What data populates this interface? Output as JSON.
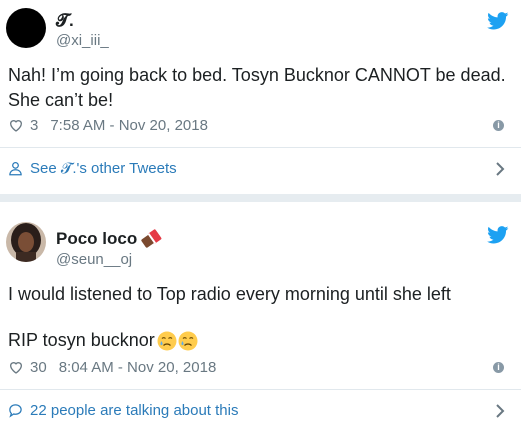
{
  "tweet1": {
    "name": "𝓣.",
    "handle": "@xi_iii_",
    "text_line1": "Nah! I’m going back to bed. Tosyn Bucknor CANNOT be dead.",
    "text_line2": "She can’t be!",
    "likes": "3",
    "timestamp": "7:58 AM - Nov 20, 2018",
    "footer": "See 𝓣.'s other Tweets",
    "footer_icon": "person-icon"
  },
  "tweet2": {
    "name": "Poco loco",
    "handle": "@seun__oj",
    "text_line1": "I would listened to Top radio every morning until she left",
    "text_line2": "RIP tosyn bucknor",
    "likes": "30",
    "timestamp": "8:04 AM - Nov 20, 2018",
    "footer": "22 people are talking about this",
    "footer_icon": "speech-bubble-icon"
  },
  "colors": {
    "twitter_blue": "#1da1f2",
    "link_blue": "#2b7bb9",
    "meta_gray": "#697882",
    "background": "#e6ecf0"
  }
}
